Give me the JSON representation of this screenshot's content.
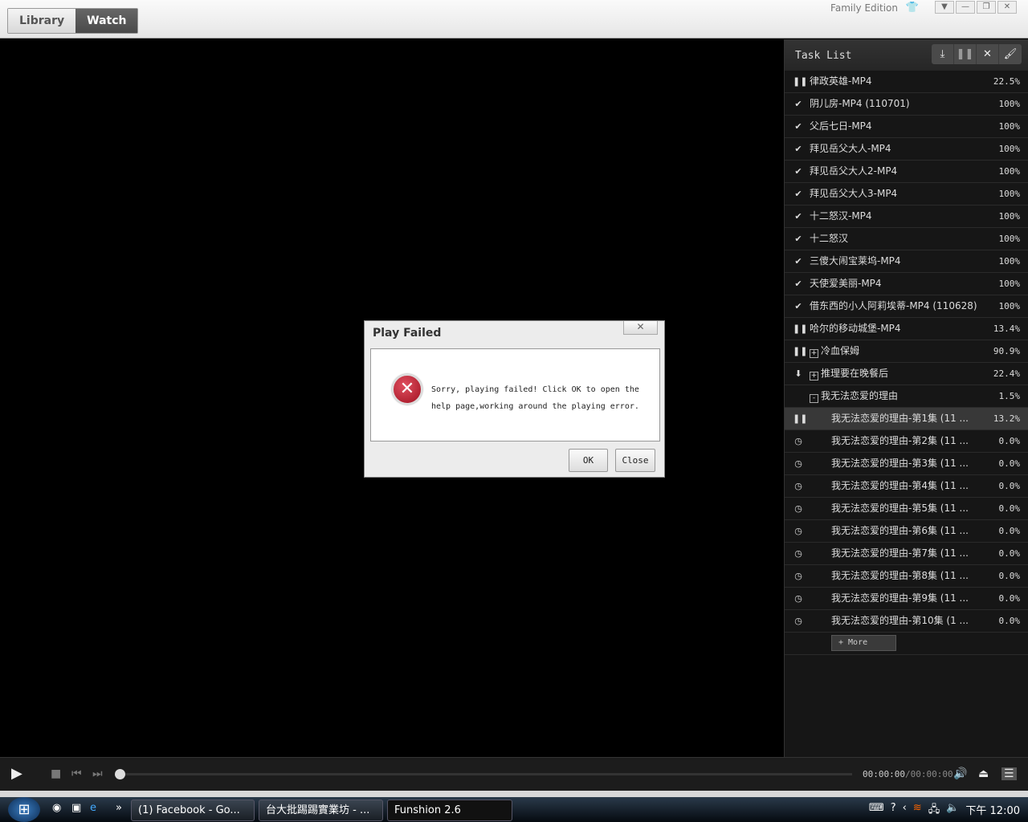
{
  "topbar": {
    "tabs": [
      "Library",
      "Watch"
    ],
    "active_tab": "Watch",
    "edition": "Family Edition"
  },
  "task_list": {
    "title": "Task List",
    "tools": [
      "download-icon",
      "pause-icon",
      "delete-icon",
      "clean-icon"
    ],
    "items": [
      {
        "status": "paused",
        "name": "律政英雄-MP4",
        "progress": "22.5%"
      },
      {
        "status": "done",
        "name": "阴儿房-MP4 (110701)",
        "progress": "100%"
      },
      {
        "status": "done",
        "name": "父后七日-MP4",
        "progress": "100%"
      },
      {
        "status": "done",
        "name": "拜见岳父大人-MP4",
        "progress": "100%"
      },
      {
        "status": "done",
        "name": "拜见岳父大人2-MP4",
        "progress": "100%"
      },
      {
        "status": "done",
        "name": "拜见岳父大人3-MP4",
        "progress": "100%"
      },
      {
        "status": "done",
        "name": "十二怒汉-MP4",
        "progress": "100%"
      },
      {
        "status": "done",
        "name": "十二怒汉",
        "progress": "100%"
      },
      {
        "status": "done",
        "name": "三傻大闹宝莱坞-MP4",
        "progress": "100%"
      },
      {
        "status": "done",
        "name": "天使爱美丽-MP4",
        "progress": "100%"
      },
      {
        "status": "done",
        "name": "借东西的小人阿莉埃蒂-MP4 (110628)",
        "progress": "100%"
      },
      {
        "status": "paused",
        "name": "哈尔的移动城堡-MP4",
        "progress": "13.4%"
      },
      {
        "status": "paused",
        "group": "+",
        "name": "冷血保姆",
        "progress": "90.9%"
      },
      {
        "status": "downloading",
        "group": "+",
        "name": "推理要在晚餐后",
        "progress": "22.4%"
      },
      {
        "status": "none",
        "group": "-",
        "name": "我无法恋爱的理由",
        "progress": "1.5%"
      },
      {
        "status": "paused",
        "child": true,
        "selected": true,
        "name": "我无法恋爱的理由-第1集 (11 ...",
        "progress": "13.2%"
      },
      {
        "status": "waiting",
        "child": true,
        "name": "我无法恋爱的理由-第2集 (11 ...",
        "progress": "0.0%"
      },
      {
        "status": "waiting",
        "child": true,
        "name": "我无法恋爱的理由-第3集 (11 ...",
        "progress": "0.0%"
      },
      {
        "status": "waiting",
        "child": true,
        "name": "我无法恋爱的理由-第4集 (11 ...",
        "progress": "0.0%"
      },
      {
        "status": "waiting",
        "child": true,
        "name": "我无法恋爱的理由-第5集 (11 ...",
        "progress": "0.0%"
      },
      {
        "status": "waiting",
        "child": true,
        "name": "我无法恋爱的理由-第6集 (11 ...",
        "progress": "0.0%"
      },
      {
        "status": "waiting",
        "child": true,
        "name": "我无法恋爱的理由-第7集 (11 ...",
        "progress": "0.0%"
      },
      {
        "status": "waiting",
        "child": true,
        "name": "我无法恋爱的理由-第8集 (11 ...",
        "progress": "0.0%"
      },
      {
        "status": "waiting",
        "child": true,
        "name": "我无法恋爱的理由-第9集 (11 ...",
        "progress": "0.0%"
      },
      {
        "status": "waiting",
        "child": true,
        "name": "我无法恋爱的理由-第10集 (1 ...",
        "progress": "0.0%"
      }
    ],
    "more_label": "+ More"
  },
  "dialog": {
    "title": "Play Failed",
    "close_x": "✕",
    "message": "Sorry, playing failed! Click OK to open the help page,working around the playing error.",
    "ok": "OK",
    "close": "Close"
  },
  "player": {
    "time_current": "00:00:00",
    "time_total": "/00:00:00",
    "progress": 0
  },
  "taskbar": {
    "windows": [
      "(1) Facebook - Go...",
      "台大批踢踢實業坊 - ...",
      "Funshion 2.6"
    ],
    "clock": "下午 12:00"
  }
}
